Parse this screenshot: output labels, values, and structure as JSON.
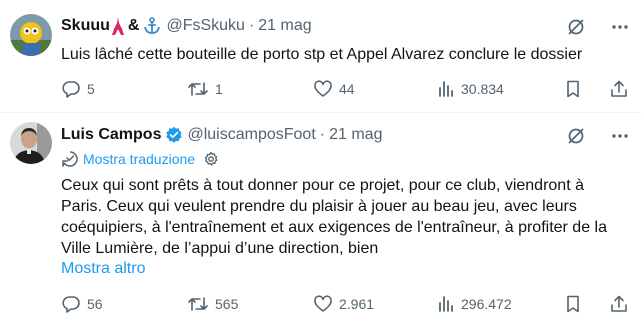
{
  "tweets": [
    {
      "name": "Skuuu",
      "name_suffix": "&",
      "handle": "@FsSkuku",
      "dot": "·",
      "time": "21 mag",
      "text": "Luis lâché cette bouteille de porto stp et Appel Alvarez conclure le dossier",
      "replies": "5",
      "reposts": "1",
      "likes": "44",
      "views": "30.834",
      "icons": {
        "emoji_1": "eiffel-tower-emoji",
        "emoji_2": "anchor-emoji",
        "grok": "grok-icon",
        "more": "more-icon"
      }
    },
    {
      "name": "Luis Campos",
      "handle": "@luiscamposFoot",
      "dot": "·",
      "time": "21 mag",
      "translate_label": "Mostra traduzione",
      "text": "Ceux qui sont prêts à tout donner pour ce projet, pour ce club, viendront à Paris. Ceux qui veulent prendre du plaisir à jouer au beau jeu, avec leurs coéquipiers, à l'entraînement et aux exigences de l'entraîneur, à profiter de la Ville Lumière, de l’appui d’une direction, bien",
      "show_more": "Mostra altro",
      "replies": "56",
      "reposts": "565",
      "likes": "2.961",
      "views": "296.472",
      "icons": {
        "verified": "verified-badge-icon",
        "translate": "translate-icon",
        "settings": "gear-icon"
      }
    }
  ],
  "colors": {
    "text": "#0f1419",
    "muted": "#536471",
    "link": "#1d9bf0",
    "divider": "#eff3f4"
  }
}
